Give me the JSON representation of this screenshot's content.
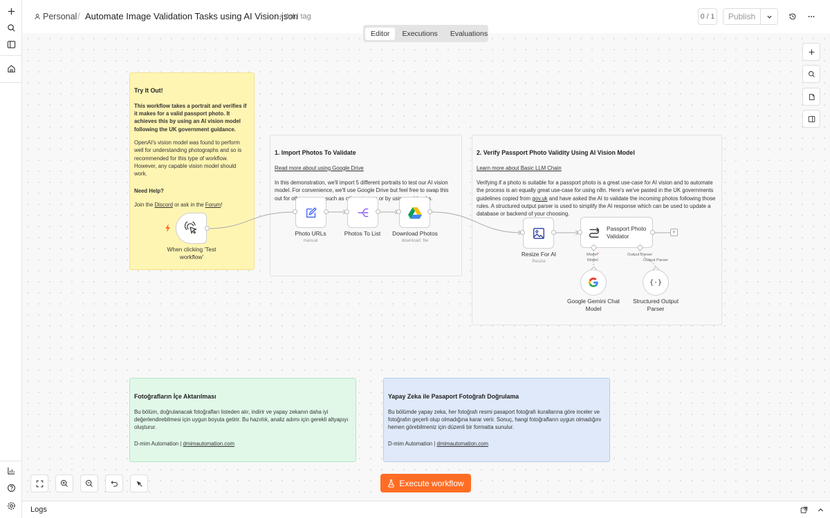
{
  "header": {
    "project": "Personal",
    "workflow_title": "Automate Image Validation Tasks using AI Vision.json",
    "add_tag": "+ Add tag",
    "counter": "0 / 1",
    "publish_label": "Publish"
  },
  "tabs": [
    {
      "label": "Editor",
      "active": true
    },
    {
      "label": "Executions",
      "active": false
    },
    {
      "label": "Evaluations",
      "active": false
    }
  ],
  "stickies": {
    "intro": {
      "title": "Try It Out!",
      "bold_text": "This workflow takes a portrait and verifies if it makes for a valid passport photo. It achieves this by using an AI vision model following the UK government guidance.",
      "text": "OpenAI's vision model was found to perform well for understanding photographs and so is recommended for this type of workflow. However, any capable vision model should work.",
      "help_title": "Need Help?",
      "help_prefix": "Join the ",
      "help_link1": "Discord",
      "help_mid": " or ask in the ",
      "help_link2": "Forum",
      "help_suffix": "!"
    },
    "import": {
      "title": "1. Import Photos To Validate",
      "link": "Read more about using Google Drive",
      "text": "In this demonstration, we'll import 5 different portraits to test our AI vision model. For convenience, we'll use Google Drive but feel free to swap this out for other sources such as other storage or by using webhooks."
    },
    "verify": {
      "title": "2. Verify Passport Photo Validity Using AI Vision Model",
      "link": "Learn more about Basic LLM Chain",
      "text_prefix": "Verifying if a photo is suitable for a passport photo is a great use-case for AI vision and to automate the process is an equally great use-case for using n8n. Here's we've pasted in the UK governments guidelines copied from ",
      "text_link": "gov.uk",
      "text_suffix": " and have asked the AI to validate the incoming photos following those rules. A structured output parser is used to simplify the AI response which can be used to update a database or backend of your choosing."
    },
    "tr_import": {
      "title": "Fotoğrafların İçe Aktarılması",
      "text": "Bu bölüm, doğrulanacak fotoğrafları listeden alır, indirir ve yapay zekanın daha iyi değerlendirebilmesi için uygun boyuta getirir. Bu hazırlık, analiz adımı için gerekli altyapıyı oluşturur.",
      "credit_prefix": "D-mim Automation | ",
      "credit_link": "dmimautomation.com"
    },
    "tr_verify": {
      "title": "Yapay Zeka ile Pasaport Fotoğrafı Doğrulama",
      "text": "Bu bölümde yapay zeka, her fotoğrafı resmi pasaport fotoğrafı kurallarına göre inceler ve fotoğrafın geçerli olup olmadığına karar verir. Sonuç, hangi fotoğrafların uygun olmadığını hemen görebilmeniz için düzenli bir formatta sunulur.",
      "credit_prefix": "D-mim Automation | ",
      "credit_link": "dmimautomation.com"
    }
  },
  "nodes": {
    "trigger": {
      "label": "When clicking 'Test workflow'"
    },
    "photo_urls": {
      "label": "Photo URLs",
      "sub": "manual"
    },
    "photos_to_list": {
      "label": "Photos To List"
    },
    "download_photos": {
      "label": "Download Photos",
      "sub": "download: file"
    },
    "resize": {
      "label": "Resize For AI",
      "sub": "Resize"
    },
    "validator": {
      "label": "Passport Photo Validator"
    },
    "model_port_label": "Model",
    "model_port_required": "*",
    "parser_port_label": "Output Parser",
    "gemini": {
      "label": "Google Gemini Chat Model",
      "port_label": "Model"
    },
    "parser": {
      "label": "Structured Output Parser",
      "port_label": "Output Parser"
    }
  },
  "execute_label": "Execute workflow",
  "logs_label": "Logs",
  "colors": {
    "accent": "#ff6d24",
    "sticky_yellow": "#fff5b3",
    "sticky_green": "#e1f8e9",
    "sticky_blue": "#dfe9f9"
  }
}
